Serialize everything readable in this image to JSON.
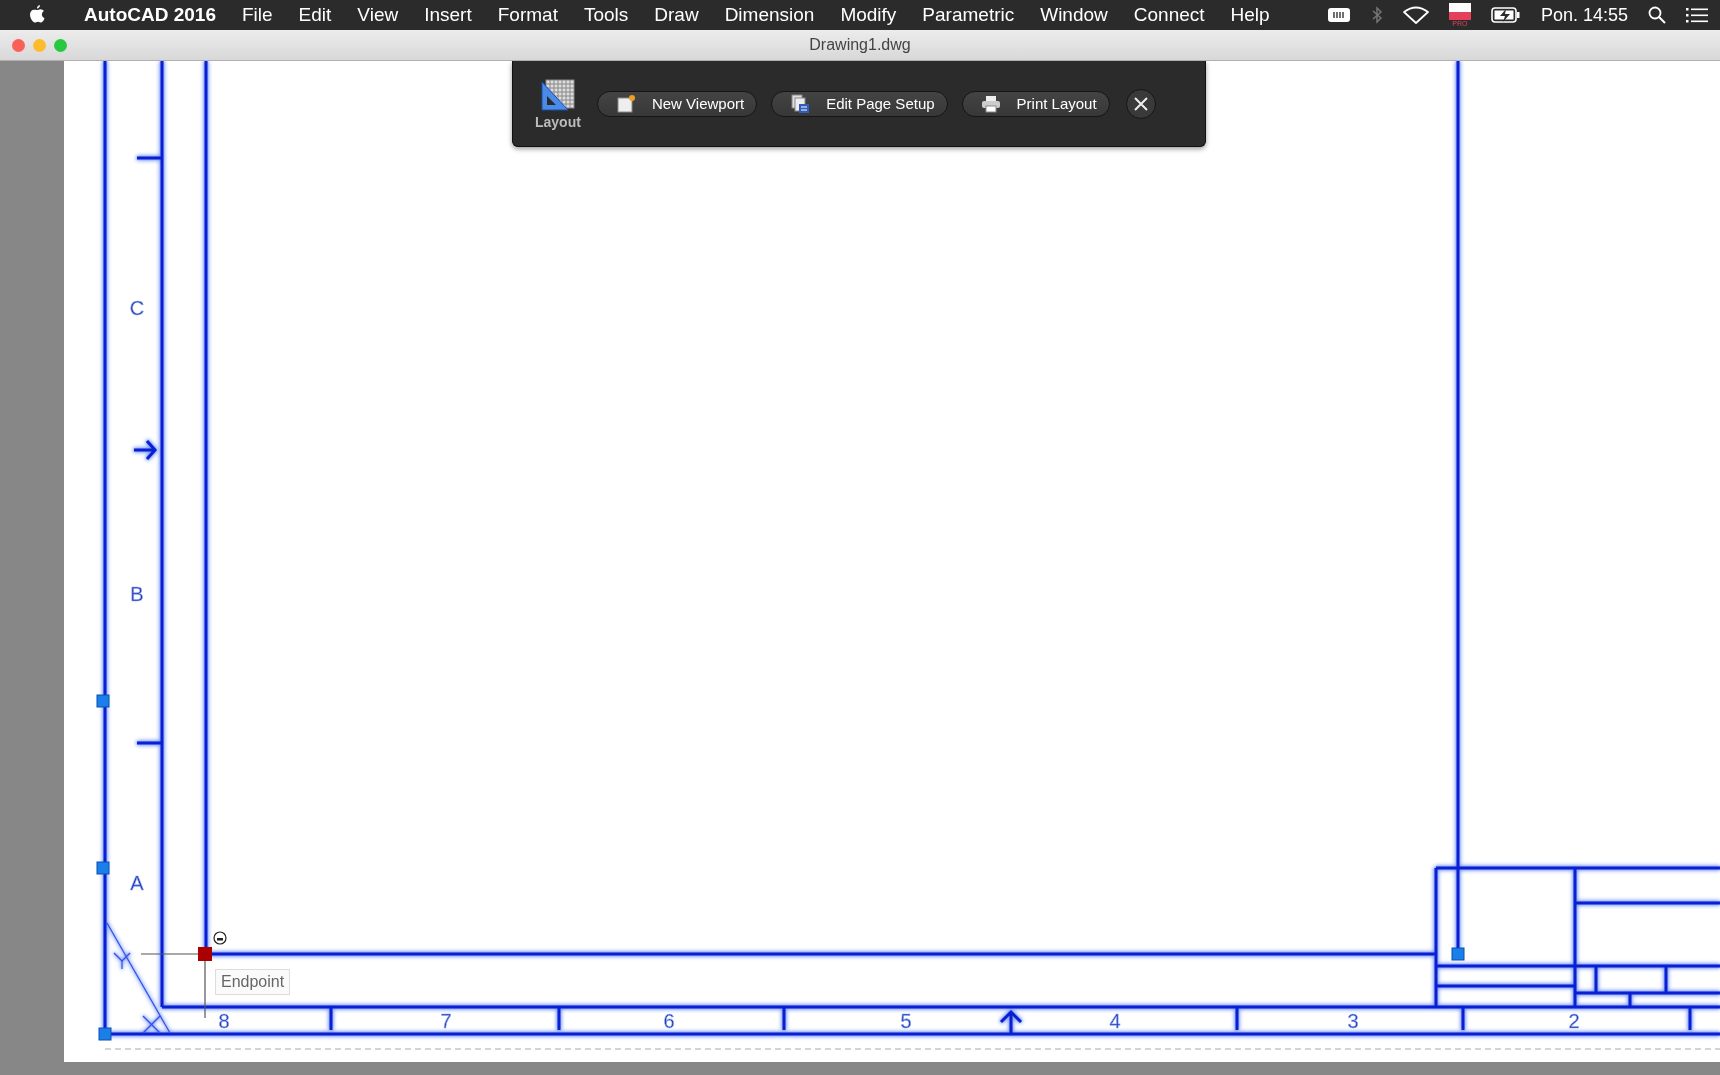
{
  "menu_bar": {
    "app_name": "AutoCAD 2016",
    "menus": [
      "File",
      "Edit",
      "View",
      "Insert",
      "Format",
      "Tools",
      "Draw",
      "Dimension",
      "Modify",
      "Parametric",
      "Window",
      "Connect",
      "Help"
    ],
    "flag_badge": "PRO",
    "clock": "Pon. 14:55"
  },
  "window": {
    "title": "Drawing1.dwg"
  },
  "toolbar": {
    "label": "Layout",
    "buttons": [
      {
        "kind": "viewport",
        "label": "New Viewport"
      },
      {
        "kind": "page-setup",
        "label": "Edit Page Setup"
      },
      {
        "kind": "print",
        "label": "Print Layout"
      }
    ]
  },
  "drawing": {
    "row_labels": [
      "C",
      "B",
      "A"
    ],
    "column_labels": [
      "8",
      "7",
      "6",
      "5",
      "4",
      "3",
      "2"
    ],
    "snap_tooltip": "Endpoint"
  }
}
